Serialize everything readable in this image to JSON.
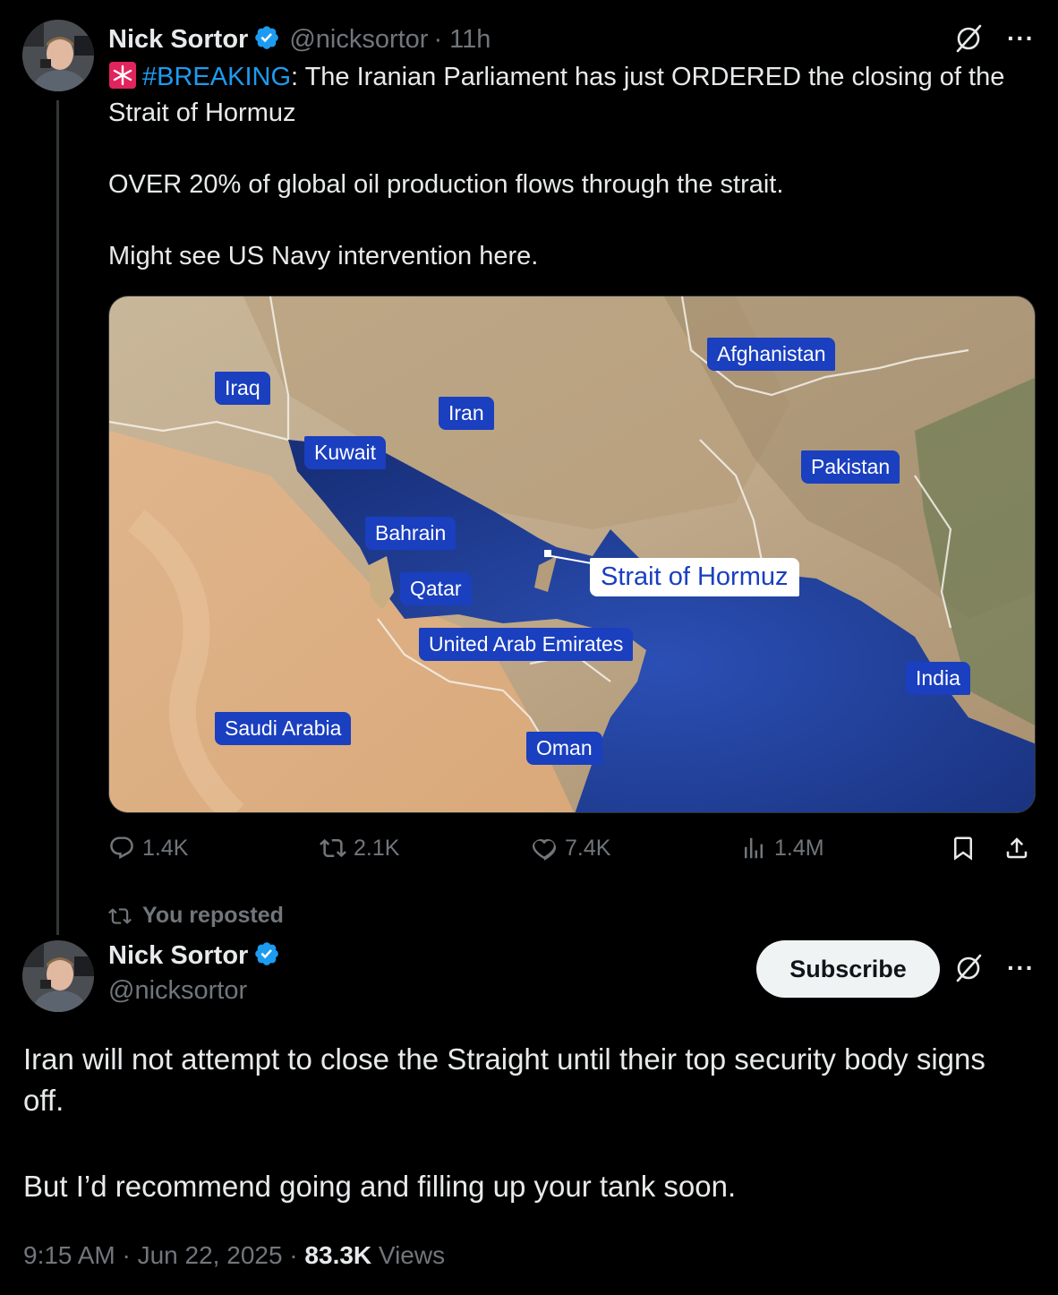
{
  "colors": {
    "background": "#000000",
    "text": "#e7e9ea",
    "muted": "#71767b",
    "link": "#1d9bf0",
    "verified": "#1d9bf0",
    "map_label": "#1a3fbf"
  },
  "tweet1": {
    "author_name": "Nick Sortor",
    "handle": "@nicksortor",
    "time": "· 11h",
    "icons": [
      "verified-badge-icon",
      "grok-icon",
      "more-icon",
      "siren-emoji-icon"
    ],
    "hashtag": "#BREAKING",
    "line1_rest": ": The Iranian Parliament has just ORDERED the closing of the Strait of Hormuz",
    "paragraph2": "OVER 20% of global oil production flows through the strait.",
    "paragraph3": "Might see US Navy intervention here.",
    "map_labels": {
      "iraq": "Iraq",
      "iran": "Iran",
      "afghanistan": "Afghanistan",
      "kuwait": "Kuwait",
      "pakistan": "Pakistan",
      "bahrain": "Bahrain",
      "qatar": "Qatar",
      "strait": "Strait of Hormuz",
      "uae": "United Arab Emirates",
      "india": "India",
      "saudi": "Saudi Arabia",
      "oman": "Oman"
    },
    "stats": {
      "replies": "1.4K",
      "reposts": "2.1K",
      "likes": "7.4K",
      "views": "1.4M"
    }
  },
  "repost_notice": "You reposted",
  "tweet2": {
    "author_name": "Nick Sortor",
    "handle": "@nicksortor",
    "subscribe_label": "Subscribe",
    "paragraph1": "Iran will not attempt to close the Straight until their top security body signs off.",
    "paragraph2": "But I’d recommend going and filling up your tank soon.",
    "time": "9:15 AM · Jun 22, 2025 · ",
    "views_count": "83.3K",
    "views_label": " Views"
  }
}
